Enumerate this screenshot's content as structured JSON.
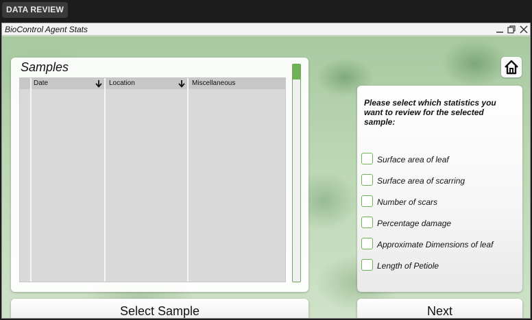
{
  "topbar": {
    "tab_label": "DATA REVIEW"
  },
  "window": {
    "title": "BioControl Agent Stats"
  },
  "samples": {
    "title": "Samples",
    "columns": [
      "Date",
      "Location",
      "Miscellaneous"
    ]
  },
  "stats": {
    "prompt": "Please select which statistics you want to review for the selected sample:",
    "options": [
      "Surface area of leaf",
      "Surface area of scarring",
      "Number of scars",
      "Percentage damage",
      "Approximate Dimensions of leaf",
      "Length of Petiole"
    ]
  },
  "buttons": {
    "select_sample": "Select Sample",
    "next": "Next"
  },
  "colors": {
    "accent": "#6fb257",
    "panel": "#ffffff",
    "table": "#d9d9d9"
  },
  "icons": {
    "home": "home-icon",
    "sort": "arrow-down-icon",
    "minimize": "minimize-icon",
    "restore": "restore-icon",
    "close": "close-icon"
  }
}
